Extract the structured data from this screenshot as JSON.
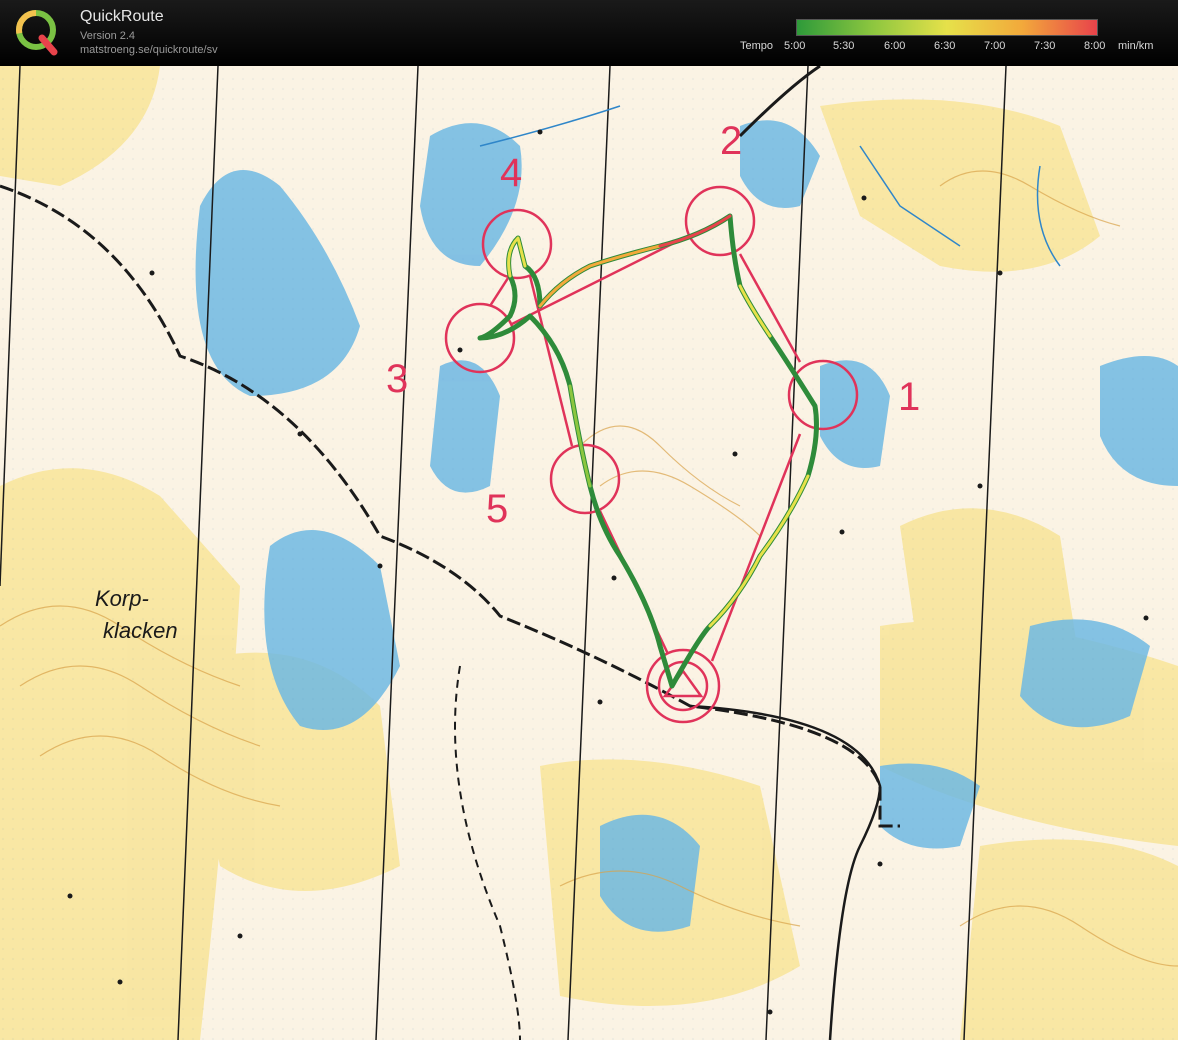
{
  "app": {
    "title": "QuickRoute",
    "version": "Version 2.4",
    "url": "matstroeng.se/quickroute/sv"
  },
  "legend": {
    "label": "Tempo",
    "ticks": [
      "5:00",
      "5:30",
      "6:00",
      "6:30",
      "7:00",
      "7:30",
      "8:00"
    ],
    "unit": "min/km",
    "gradient_colors": [
      "#2e9a3a",
      "#8cc63f",
      "#e6e14a",
      "#f2a93b",
      "#e8434b"
    ]
  },
  "map": {
    "background_color": "#fbf3e4",
    "water_color": "#6fb8e3",
    "open_land_color": "#f7dc6f",
    "course_color": "#e0335a",
    "controls": [
      "1",
      "2",
      "3",
      "4",
      "5"
    ],
    "place_name": [
      "Korp-",
      "klacken"
    ]
  }
}
